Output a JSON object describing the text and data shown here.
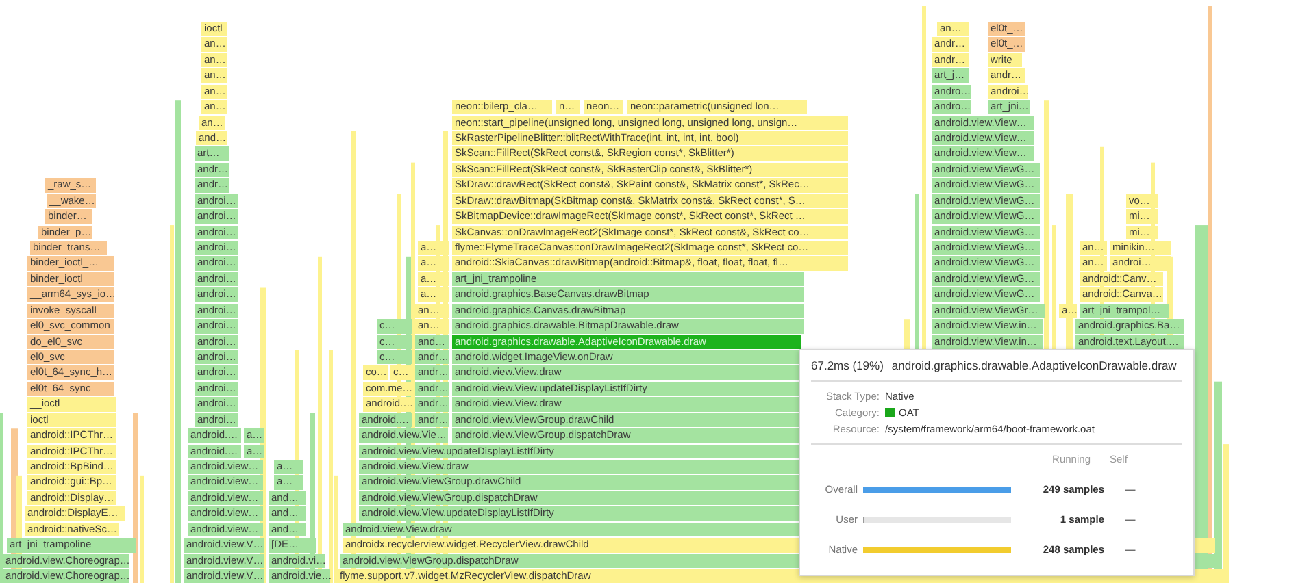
{
  "stacks": [
    {
      "rows": [
        [
          {
            "label": "_raw_s…",
            "kind": "kernel"
          }
        ],
        [
          {
            "label": "__wake…",
            "kind": "kernel"
          }
        ],
        [
          {
            "label": "binder…",
            "kind": "kernel"
          }
        ],
        [
          {
            "label": "binder_p…",
            "kind": "kernel"
          }
        ],
        [
          {
            "label": "binder_trans…",
            "kind": "kernel"
          }
        ],
        [
          {
            "label": "binder_ioctl_…",
            "kind": "kernel"
          }
        ],
        [
          {
            "label": "binder_ioctl",
            "kind": "kernel"
          }
        ],
        [
          {
            "label": "__arm64_sys_io…",
            "kind": "kernel"
          }
        ],
        [
          {
            "label": "invoke_syscall",
            "kind": "kernel"
          }
        ],
        [
          {
            "label": "el0_svc_common",
            "kind": "kernel"
          }
        ],
        [
          {
            "label": "do_el0_svc",
            "kind": "kernel"
          }
        ],
        [
          {
            "label": "el0_svc",
            "kind": "kernel"
          }
        ],
        [
          {
            "label": "el0t_64_sync_h…",
            "kind": "kernel"
          }
        ],
        [
          {
            "label": "el0t_64_sync",
            "kind": "kernel"
          }
        ],
        [
          {
            "label": "__ioctl",
            "kind": "native"
          }
        ],
        [
          {
            "label": "ioctl",
            "kind": "native"
          }
        ],
        [
          {
            "label": "android::IPCThr…",
            "kind": "native"
          }
        ],
        [
          {
            "label": "android::IPCThr…",
            "kind": "native"
          }
        ],
        [
          {
            "label": "android::BpBind…",
            "kind": "native"
          }
        ],
        [
          {
            "label": "android::gui::Bp…",
            "kind": "native"
          }
        ],
        [
          {
            "label": "android::Display…",
            "kind": "native"
          }
        ],
        [
          {
            "label": "android::DisplayE…",
            "kind": "native"
          }
        ],
        [
          {
            "label": "android::nativeSc…",
            "kind": "native"
          }
        ],
        [
          {
            "label": "art_jni_trampoline",
            "kind": "java"
          }
        ],
        [
          {
            "label": "android.view.Choreograp…",
            "kind": "java"
          }
        ],
        [
          {
            "label": "android.view.Choreograp…",
            "kind": "java"
          }
        ]
      ]
    },
    {
      "rows": [
        [
          {
            "label": "ioctl",
            "kind": "native"
          }
        ],
        [
          {
            "label": "an…",
            "kind": "native"
          }
        ],
        [
          {
            "label": "an…",
            "kind": "native"
          }
        ],
        [
          {
            "label": "an…",
            "kind": "native"
          }
        ],
        [
          {
            "label": "an…",
            "kind": "native"
          }
        ],
        [
          {
            "label": "an…",
            "kind": "native"
          }
        ],
        [
          {
            "label": "an…",
            "kind": "native"
          }
        ],
        [
          {
            "label": "and…",
            "kind": "native"
          }
        ],
        [
          {
            "label": "art…",
            "kind": "java"
          }
        ],
        [
          {
            "label": "andr…",
            "kind": "java"
          }
        ],
        [
          {
            "label": "andr…",
            "kind": "java"
          }
        ],
        [
          {
            "label": "androi…",
            "kind": "java"
          }
        ],
        [
          {
            "label": "androi…",
            "kind": "java"
          }
        ],
        [
          {
            "label": "androi…",
            "kind": "java"
          }
        ],
        [
          {
            "label": "androi…",
            "kind": "java"
          }
        ],
        [
          {
            "label": "androi…",
            "kind": "java"
          }
        ],
        [
          {
            "label": "androi…",
            "kind": "java"
          }
        ],
        [
          {
            "label": "androi…",
            "kind": "java"
          }
        ],
        [
          {
            "label": "androi…",
            "kind": "java"
          }
        ],
        [
          {
            "label": "androi…",
            "kind": "java"
          }
        ],
        [
          {
            "label": "androi…",
            "kind": "java"
          }
        ],
        [
          {
            "label": "androi…",
            "kind": "java"
          }
        ],
        [
          {
            "label": "androi…",
            "kind": "java"
          }
        ],
        [
          {
            "label": "androi…",
            "kind": "java"
          }
        ],
        [
          {
            "label": "androi…",
            "kind": "java"
          }
        ],
        [
          {
            "label": "androi…",
            "kind": "java"
          }
        ],
        [
          {
            "label": "android.…",
            "kind": "java"
          },
          {
            "label": "a…",
            "kind": "java"
          }
        ],
        [
          {
            "label": "android.…",
            "kind": "java"
          },
          {
            "label": "a…",
            "kind": "java"
          }
        ],
        [
          {
            "label": "android.view…",
            "kind": "java"
          },
          {
            "label": "a…",
            "kind": "java"
          }
        ],
        [
          {
            "label": "android.view…",
            "kind": "java"
          },
          {
            "label": "a…",
            "kind": "java"
          }
        ],
        [
          {
            "label": "android.view…",
            "kind": "java"
          },
          {
            "label": "and…",
            "kind": "java"
          }
        ],
        [
          {
            "label": "android.view…",
            "kind": "java"
          },
          {
            "label": "and…",
            "kind": "java"
          }
        ],
        [
          {
            "label": "android.view…",
            "kind": "java"
          },
          {
            "label": "and…",
            "kind": "java"
          }
        ],
        [
          {
            "label": "android.view.V…",
            "kind": "java"
          },
          {
            "label": "[DE…",
            "kind": "java"
          }
        ],
        [
          {
            "label": "android.view.V…",
            "kind": "java"
          },
          {
            "label": "android.vi…",
            "kind": "java"
          }
        ],
        [
          {
            "label": "android.view.V…",
            "kind": "java"
          },
          {
            "label": "android.vie…",
            "kind": "java"
          }
        ]
      ]
    },
    {
      "rows": [
        [
          {
            "label": "neon::bilerp_cla…",
            "kind": "native"
          },
          {
            "label": "n…",
            "kind": "native"
          },
          {
            "label": "neon…",
            "kind": "native"
          },
          {
            "label": "neon::parametric(unsigned lon…",
            "kind": "native"
          }
        ],
        [
          {
            "label": "neon::start_pipeline(unsigned long, unsigned long, unsigned long, unsign…",
            "kind": "native"
          }
        ],
        [
          {
            "label": "SkRasterPipelineBlitter::blitRectWithTrace(int, int, int, int, bool)",
            "kind": "native"
          }
        ],
        [
          {
            "label": "SkScan::FillRect(SkRect const&, SkRegion const*, SkBlitter*)",
            "kind": "native"
          }
        ],
        [
          {
            "label": "SkScan::FillRect(SkRect const&, SkRasterClip const&, SkBlitter*)",
            "kind": "native"
          }
        ],
        [
          {
            "label": "SkDraw::drawRect(SkRect const&, SkPaint const&, SkMatrix const*, SkRec…",
            "kind": "native"
          }
        ],
        [
          {
            "label": "SkDraw::drawBitmap(SkBitmap const&, SkMatrix const&, SkRect const*, S…",
            "kind": "native"
          }
        ],
        [
          {
            "label": "SkBitmapDevice::drawImageRect(SkImage const*, SkRect const*, SkRect …",
            "kind": "native"
          }
        ],
        [
          {
            "label": "SkCanvas::onDrawImageRect2(SkImage const*, SkRect const&, SkRect co…",
            "kind": "native"
          }
        ],
        [
          {
            "label": "flyme::FlymeTraceCanvas::onDrawImageRect2(SkImage const*, SkRect co…",
            "kind": "native"
          }
        ],
        [
          {
            "label": "android::SkiaCanvas::drawBitmap(android::Bitmap&, float, float, float, fl…",
            "kind": "native"
          }
        ],
        [
          {
            "label": "art_jni_trampoline",
            "kind": "java"
          }
        ],
        [
          {
            "label": "android.graphics.BaseCanvas.drawBitmap",
            "kind": "java"
          }
        ],
        [
          {
            "label": "android.graphics.Canvas.drawBitmap",
            "kind": "java"
          }
        ],
        [
          {
            "label": "android.graphics.drawable.BitmapDrawable.draw",
            "kind": "java"
          }
        ],
        [
          {
            "label": "android.graphics.drawable.AdaptiveIconDrawable.draw",
            "kind": "highlight"
          }
        ],
        [
          {
            "label": "android.widget.ImageView.onDraw",
            "kind": "java"
          }
        ],
        [
          {
            "label": "android.view.View.draw",
            "kind": "java"
          }
        ],
        [
          {
            "label": "android.view.View.updateDisplayListIfDirty",
            "kind": "java"
          }
        ],
        [
          {
            "label": "android.view.View.draw",
            "kind": "java"
          }
        ],
        [
          {
            "label": "android.view.ViewGroup.drawChild",
            "kind": "java"
          }
        ],
        [
          {
            "label": "android.view.ViewGroup.dispatchDraw",
            "kind": "java"
          }
        ],
        [
          {
            "label": "android.view.View.updateDisplayListIfDirty",
            "kind": "java"
          }
        ],
        [
          {
            "label": "android.view.View.draw",
            "kind": "java"
          }
        ],
        [
          {
            "label": "android.view.ViewGroup.drawChild",
            "kind": "java"
          }
        ],
        [
          {
            "label": "android.view.ViewGroup.dispatchDraw",
            "kind": "java"
          }
        ],
        [
          {
            "label": "android.view.View.updateDisplayListIfDirty",
            "kind": "java"
          }
        ],
        [
          {
            "label": "android.view.View.draw",
            "kind": "java"
          }
        ],
        [
          {
            "label": "androidx.recyclerview.widget.RecyclerView.drawChild",
            "kind": "native"
          }
        ],
        [
          {
            "label": "android.view.ViewGroup.dispatchDraw",
            "kind": "java"
          }
        ],
        [
          {
            "label": "flyme.support.v7.widget.MzRecyclerView.dispatchDraw",
            "kind": "native"
          }
        ]
      ]
    },
    {
      "rows": [
        [
          {
            "label": "c…",
            "kind": "java"
          }
        ],
        [
          {
            "label": "c…",
            "kind": "java"
          }
        ],
        [
          {
            "label": "c…",
            "kind": "java"
          }
        ],
        [
          {
            "label": "co…",
            "kind": "native"
          },
          {
            "label": "c…",
            "kind": "native"
          }
        ],
        [
          {
            "label": "com.me…",
            "kind": "native"
          }
        ],
        [
          {
            "label": "android.…",
            "kind": "native"
          }
        ],
        [
          {
            "label": "android.…",
            "kind": "java"
          }
        ],
        [
          {
            "label": "android.view.Vie…",
            "kind": "java"
          }
        ]
      ]
    },
    {
      "rows": [
        [
          {
            "label": "a…",
            "kind": "native"
          }
        ],
        [
          {
            "label": "a…",
            "kind": "native"
          }
        ],
        [
          {
            "label": "a…",
            "kind": "native"
          }
        ],
        [
          {
            "label": "a…",
            "kind": "native"
          }
        ],
        [
          {
            "label": "an…",
            "kind": "native"
          }
        ],
        [
          {
            "label": "an…",
            "kind": "native"
          }
        ],
        [
          {
            "label": "and…",
            "kind": "java"
          }
        ],
        [
          {
            "label": "andr…",
            "kind": "java"
          }
        ],
        [
          {
            "label": "andr…",
            "kind": "java"
          }
        ],
        [
          {
            "label": "andr…",
            "kind": "java"
          }
        ],
        [
          {
            "label": "andr…",
            "kind": "java"
          }
        ],
        [
          {
            "label": "andr…",
            "kind": "java"
          }
        ]
      ]
    },
    {
      "rows": [
        [
          {
            "label": "an…",
            "kind": "native"
          },
          {
            "label": "el0t_…",
            "kind": "kernel"
          }
        ],
        [
          {
            "label": "andr…",
            "kind": "native"
          },
          {
            "label": "el0t_…",
            "kind": "kernel"
          }
        ],
        [
          {
            "label": "andr…",
            "kind": "native"
          },
          {
            "label": "write",
            "kind": "native"
          }
        ],
        [
          {
            "label": "art_j…",
            "kind": "java"
          },
          {
            "label": "andr…",
            "kind": "native"
          }
        ],
        [
          {
            "label": "andro…",
            "kind": "java"
          },
          {
            "label": "androi…",
            "kind": "native"
          }
        ],
        [
          {
            "label": "andro…",
            "kind": "java"
          },
          {
            "label": "art_jni…",
            "kind": "java"
          }
        ],
        [
          {
            "label": "android.view.View…",
            "kind": "java"
          }
        ],
        [
          {
            "label": "android.view.View…",
            "kind": "java"
          }
        ],
        [
          {
            "label": "android.view.View…",
            "kind": "java"
          }
        ],
        [
          {
            "label": "android.view.ViewG…",
            "kind": "java"
          }
        ],
        [
          {
            "label": "android.view.ViewG…",
            "kind": "java"
          }
        ],
        [
          {
            "label": "android.view.ViewG…",
            "kind": "java"
          }
        ],
        [
          {
            "label": "android.view.ViewG…",
            "kind": "java"
          }
        ],
        [
          {
            "label": "android.view.ViewG…",
            "kind": "java"
          }
        ],
        [
          {
            "label": "android.view.ViewG…",
            "kind": "java"
          }
        ],
        [
          {
            "label": "android.view.ViewG…",
            "kind": "java"
          }
        ],
        [
          {
            "label": "android.view.ViewG…",
            "kind": "java"
          }
        ],
        [
          {
            "label": "android.view.ViewG…",
            "kind": "java"
          }
        ],
        [
          {
            "label": "android.view.ViewGr…",
            "kind": "java"
          }
        ],
        [
          {
            "label": "android.view.View.in…",
            "kind": "java"
          }
        ],
        [
          {
            "label": "android.view.View.in…",
            "kind": "java"
          }
        ]
      ]
    },
    {
      "rows": [
        [
          {
            "label": "vo…",
            "kind": "native"
          }
        ],
        [
          {
            "label": "mi…",
            "kind": "native"
          }
        ],
        [
          {
            "label": "mi…",
            "kind": "native"
          }
        ],
        [
          {
            "label": "an…",
            "kind": "native"
          },
          {
            "label": "minikin…",
            "kind": "native"
          }
        ],
        [
          {
            "label": "an…",
            "kind": "native"
          },
          {
            "label": "androi…",
            "kind": "native"
          }
        ],
        [
          {
            "label": "android::Canv…",
            "kind": "native"
          }
        ],
        [
          {
            "label": "android::Canva…",
            "kind": "native"
          }
        ],
        [
          {
            "label": "a…",
            "kind": "native"
          },
          {
            "label": "art_jni_trampol…",
            "kind": "java"
          }
        ],
        [
          {
            "label": "android.graphics.Ba…",
            "kind": "java"
          }
        ],
        [
          {
            "label": "android.text.Layout.…",
            "kind": "java"
          }
        ]
      ]
    }
  ],
  "tooltip": {
    "duration": "67.2ms (19%)",
    "name": "android.graphics.drawable.AdaptiveIconDrawable.draw",
    "details": [
      {
        "label": "Stack Type:",
        "value": "Native"
      },
      {
        "label": "Category:",
        "value": "OAT",
        "color": "#1aa71a"
      },
      {
        "label": "Resource:",
        "value": "/system/framework/arm64/boot-framework.oat"
      }
    ],
    "columns": [
      "Running",
      "Self"
    ],
    "rows": [
      {
        "label": "Overall",
        "level": 1,
        "color": "#4a9de8",
        "value": "249 samples",
        "self": "—"
      },
      {
        "label": "User",
        "level": 0.004,
        "color": "#9a9a9a",
        "value": "1 sample",
        "self": "—"
      },
      {
        "label": "Native",
        "level": 0.996,
        "color": "#f2cc2f",
        "value": "248 samples",
        "self": "—"
      }
    ]
  }
}
